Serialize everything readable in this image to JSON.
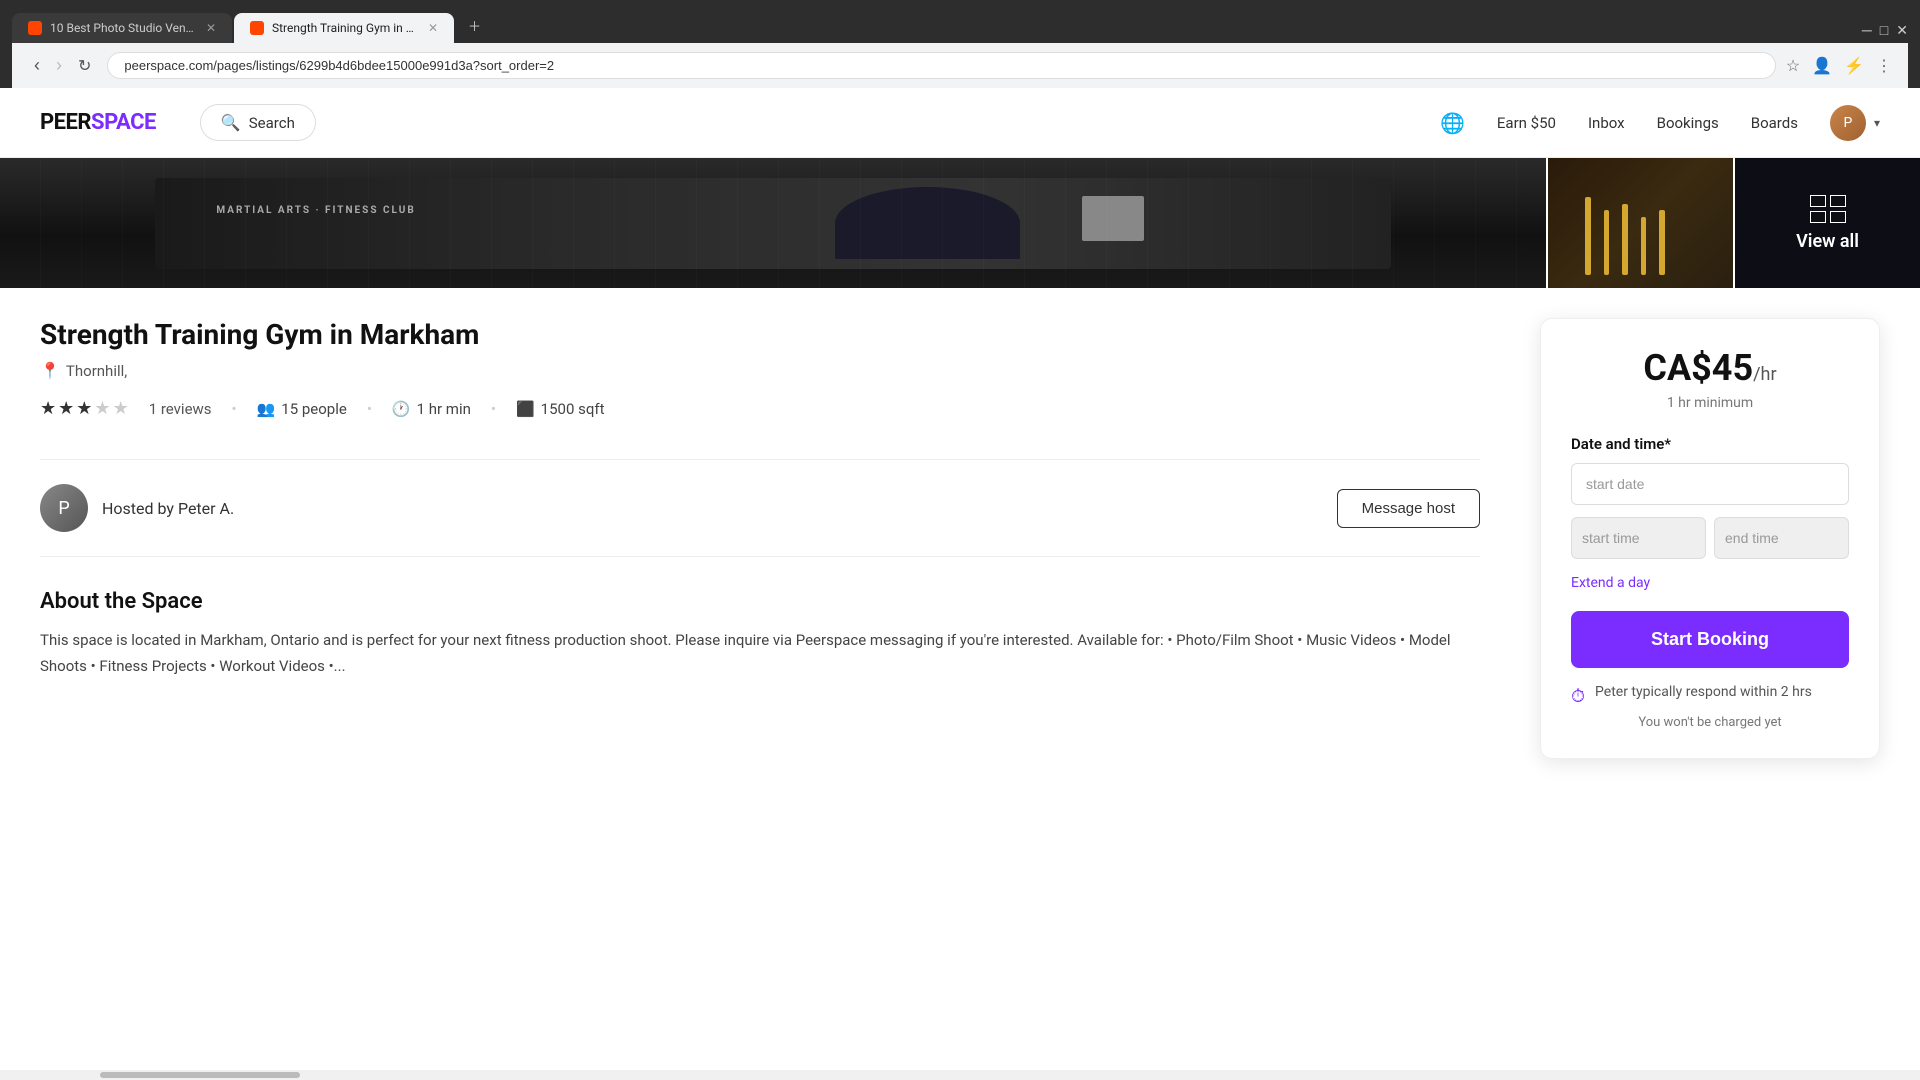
{
  "browser": {
    "tabs": [
      {
        "id": 1,
        "title": "10 Best Photo Studio Venues -",
        "active": false
      },
      {
        "id": 2,
        "title": "Strength Training Gym in Markh...",
        "active": true
      }
    ],
    "url": "peerspace.com/pages/listings/6299b4d6bdee15000e991d3a?sort_order=2"
  },
  "navbar": {
    "logo": "PEERSPACE",
    "search_label": "Search",
    "earn_label": "Earn $50",
    "inbox_label": "Inbox",
    "bookings_label": "Bookings",
    "boards_label": "Boards"
  },
  "images": {
    "view_all_label": "View all"
  },
  "listing": {
    "title": "Strength Training Gym in Markham",
    "location": "Thornhill,",
    "reviews_count": "1 reviews",
    "people": "15 people",
    "duration": "1 hr min",
    "sqft": "1500 sqft",
    "stars": 3,
    "host_name": "Hosted by Peter A.",
    "message_host_label": "Message host",
    "about_title": "About the Space",
    "about_text": "This space is located in Markham, Ontario and is perfect for your next fitness production shoot. Please inquire via Peerspace messaging if you're interested. Available for: • Photo/Film Shoot • Music Videos • Model Shoots • Fitness Projects • Workout Videos •..."
  },
  "booking": {
    "price": "CA$45",
    "price_unit": "/hr",
    "price_min": "1 hr minimum",
    "date_label": "Date and time*",
    "date_placeholder": "start date",
    "start_time_placeholder": "start time",
    "end_time_placeholder": "end time",
    "extend_day_label": "Extend a day",
    "start_booking_label": "Start Booking",
    "response_text": "Peter typically respond within 2 hrs",
    "no_charge_text": "You won't be charged yet"
  }
}
